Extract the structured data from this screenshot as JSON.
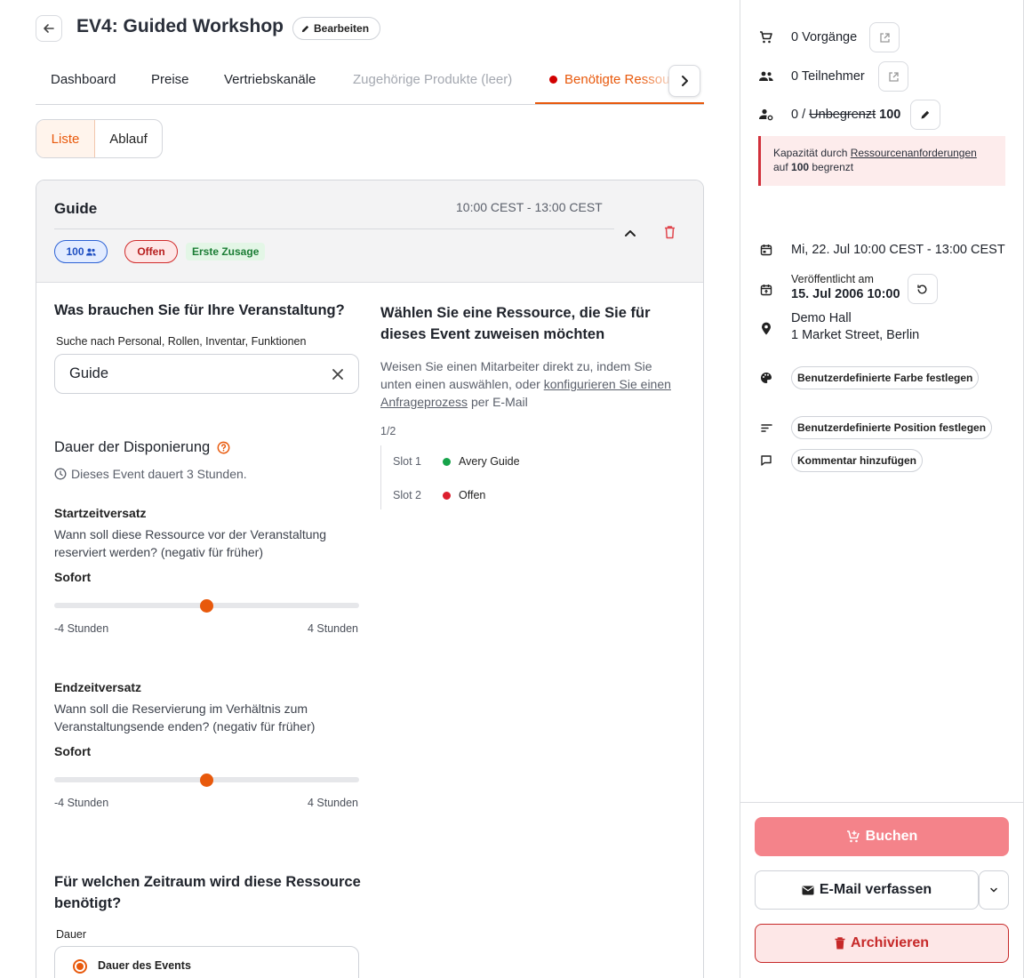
{
  "header": {
    "title": "EV4: Guided Workshop",
    "edit_label": "Bearbeiten"
  },
  "tabs": [
    {
      "label": "Dashboard",
      "state": "normal"
    },
    {
      "label": "Preise",
      "state": "normal"
    },
    {
      "label": "Vertriebskanäle",
      "state": "normal"
    },
    {
      "label": "Zugehörige Produkte (leer)",
      "state": "disabled"
    },
    {
      "label": "Benötigte Ressourcen",
      "state": "active"
    }
  ],
  "view_toggle": {
    "list": "Liste",
    "flow": "Ablauf",
    "selected": "Liste"
  },
  "resource": {
    "name": "Guide",
    "time": "10:00 CEST - 13:00 CEST",
    "capacity_badge": "100",
    "status_badge": "Offen",
    "commitment_badge": "Erste Zusage",
    "question": "Was brauchen Sie für Ihre Veranstaltung?",
    "search_label": "Suche nach Personal, Rollen, Inventar, Funktionen",
    "search_value": "Guide",
    "duration_title": "Dauer der Disponierung",
    "duration_note": "Dieses Event dauert 3 Stunden.",
    "start_offset": {
      "title": "Startzeitversatz",
      "description": "Wann soll diese Ressource vor der Veranstaltung reserviert werden? (negativ für früher)",
      "value_label": "Sofort",
      "min_label": "-4 Stunden",
      "max_label": "4 Stunden",
      "value": 0,
      "min": -4,
      "max": 4
    },
    "end_offset": {
      "title": "Endzeitversatz",
      "description": "Wann soll die Reservierung im Verhältnis zum Veranstaltungsende enden? (negativ für früher)",
      "value_label": "Sofort",
      "min_label": "-4 Stunden",
      "max_label": "4 Stunden",
      "value": 0,
      "min": -4,
      "max": 4
    },
    "period_question": "Für welchen Zeitraum wird diese Ressource benötigt?",
    "period_label": "Dauer",
    "period_option": "Dauer des Events",
    "assign_title": "Wählen Sie eine Ressource, die Sie für dieses Event zuweisen möchten",
    "assign_desc_pre": "Weisen Sie einen Mitarbeiter direkt zu, indem Sie unten einen auswählen, oder ",
    "assign_desc_link": "konfigurieren Sie einen Anfrageprozess",
    "assign_desc_post": " per E-Mail",
    "slot_fraction": "1/2",
    "slots": [
      {
        "label": "Slot 1",
        "value": "Avery Guide",
        "color": "#16a34a"
      },
      {
        "label": "Slot 2",
        "value": "Offen",
        "color": "#dc1f2e"
      }
    ]
  },
  "sidebar": {
    "orders": "0 Vorgänge",
    "participants": "0 Teilnehmer",
    "capacity_prefix": "0 / ",
    "capacity_struck": "Unbegrenzt",
    "capacity_value": "100",
    "alert_pre": "Kapazität durch ",
    "alert_link": "Ressourcenanforderungen",
    "alert_mid": "auf ",
    "alert_bold": "100",
    "alert_post": " begrenzt",
    "date": "Mi, 22. Jul 10:00 CEST - 13:00 CEST",
    "published_label": "Veröffentlicht am",
    "published_value": "15. Jul 2006 10:00",
    "venue_name": "Demo Hall",
    "venue_address": "1 Market Street, Berlin",
    "color_button": "Benutzerdefinierte Farbe festlegen",
    "position_button": "Benutzerdefinierte Position festlegen",
    "comment_button": "Kommentar hinzufügen",
    "book_button": "Buchen",
    "email_button": "E-Mail verfassen",
    "archive_button": "Archivieren"
  },
  "colors": {
    "accent": "#e8590c",
    "danger": "#c62828",
    "book_button_bg": "#f4838a",
    "alert_bg": "#fdecec"
  }
}
